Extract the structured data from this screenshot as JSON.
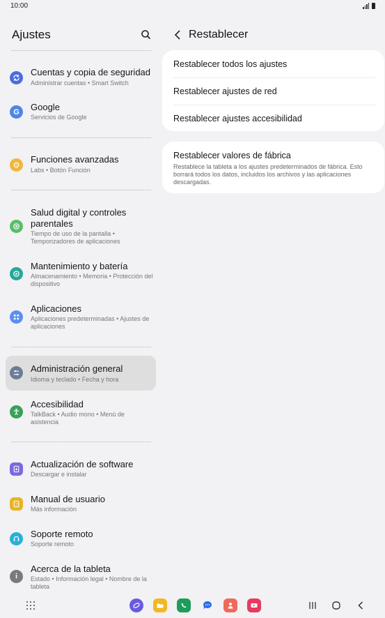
{
  "status": {
    "time": "10:00"
  },
  "left": {
    "title": "Ajustes",
    "items": [
      {
        "title": "Cuentas y copia de seguridad",
        "sub": "Administrar cuentas  •  Smart Switch",
        "icon": "sync-icon",
        "color": "#4a6ee0"
      },
      {
        "title": "Google",
        "sub": "Servicios de Google",
        "icon": "google-icon",
        "color": "#4c86e8"
      },
      {
        "title": "Funciones avanzadas",
        "sub": "Labs  •  Botón Función",
        "icon": "gear-plus-icon",
        "color": "#f2b73a"
      },
      {
        "title": "Salud digital y controles parentales",
        "sub": "Tiempo de uso de la pantalla  •  Temporizadores de aplicaciones",
        "icon": "digital-wellbeing-icon",
        "color": "#5bbd6a"
      },
      {
        "title": "Mantenimiento y batería",
        "sub": "Almacenamiento  •  Memoria  •  Protección del dispositivo",
        "icon": "device-care-icon",
        "color": "#25a89a"
      },
      {
        "title": "Aplicaciones",
        "sub": "Aplicaciones predeterminadas  •  Ajustes de aplicaciones",
        "icon": "apps-grid-icon",
        "color": "#5b8ef2"
      },
      {
        "title": "Administración general",
        "sub": "Idioma y teclado  •  Fecha y hora",
        "icon": "sliders-icon",
        "color": "#6b7c96"
      },
      {
        "title": "Accesibilidad",
        "sub": "TalkBack  •  Audio mono  •  Menú de asistencia",
        "icon": "accessibility-icon",
        "color": "#3aa05a"
      },
      {
        "title": "Actualización de software",
        "sub": "Descargar e instalar",
        "icon": "software-update-icon",
        "color": "#7d68e0"
      },
      {
        "title": "Manual de usuario",
        "sub": "Más información",
        "icon": "manual-icon",
        "color": "#e8b422"
      },
      {
        "title": "Soporte remoto",
        "sub": "Soporte remoto",
        "icon": "headset-icon",
        "color": "#2ab0d6"
      },
      {
        "title": "Acerca de la tableta",
        "sub": "Estado  •  Información legal  •  Nombre de la tableta",
        "icon": "info-icon",
        "color": "#7a7a7a"
      }
    ]
  },
  "right": {
    "title": "Restablecer",
    "card1": [
      "Restablecer todos los ajustes",
      "Restablecer ajustes de red",
      "Restablecer ajustes accesibilidad"
    ],
    "card2": {
      "title": "Restablecer valores de fábrica",
      "desc": "Restablece la tableta a los ajustes predeterminados de fábrica. Esto borrará todos los datos, incluidos los archivos y las aplicaciones descargadas."
    }
  },
  "colors": {
    "accent": "#3e7ce6",
    "active_bg": "#dedede"
  }
}
